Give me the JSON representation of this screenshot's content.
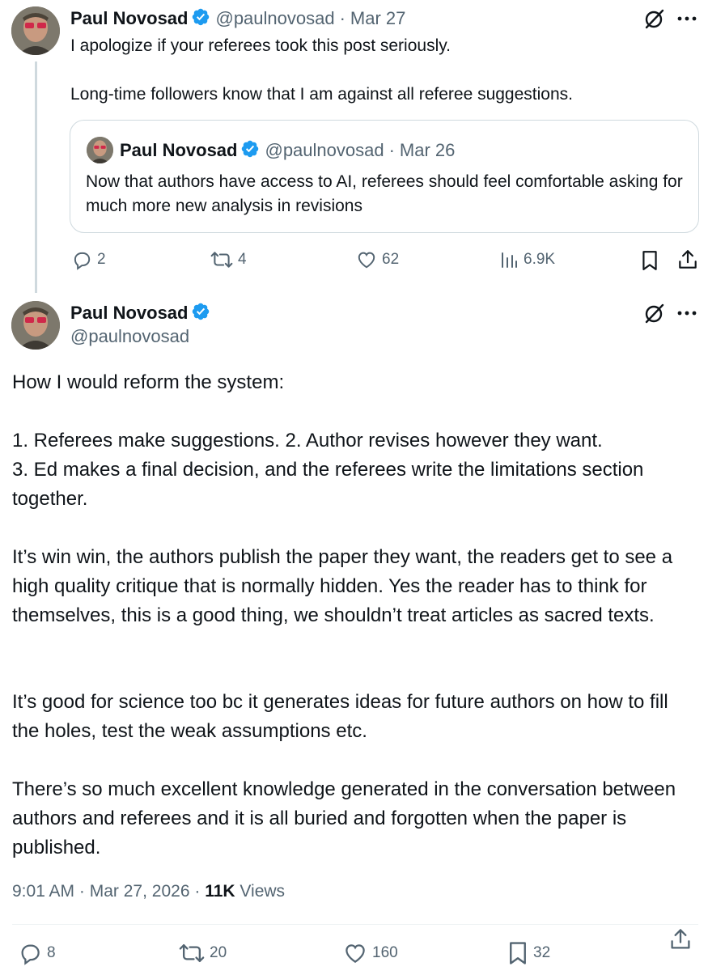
{
  "reply": {
    "author_name": "Paul Novosad",
    "handle": "@paulnovosad",
    "date": "Mar 27",
    "separator": "·",
    "lines": [
      "I apologize if your referees took this post seriously.",
      "Long-time followers know that I am against all referee suggestions."
    ],
    "quote": {
      "author_name": "Paul Novosad",
      "handle": "@paulnovosad",
      "date": "Mar 26",
      "text": "Now that authors have access to AI, referees should feel comfortable asking for much more new analysis in revisions"
    },
    "stats": {
      "replies": "2",
      "reposts": "4",
      "likes": "62",
      "views": "6.9K"
    }
  },
  "main": {
    "author_name": "Paul Novosad",
    "handle": "@paulnovosad",
    "paragraphs": [
      "How I would reform the system:",
      "1. Referees make suggestions. 2. Author revises however they want.\n3. Ed makes a final decision, and the referees write the limitations section together.",
      "It’s win win, the authors publish the paper they want, the readers get to see a high quality critique that is normally hidden. Yes the reader has to think for themselves, this is a good thing, we shouldn’t treat articles as sacred texts.",
      "It’s good for science too bc it generates ideas for future authors on how to fill the holes, test the weak assumptions etc.",
      "There’s so much excellent knowledge generated in the conversation between authors and referees and it is all buried and forgotten when the paper is published."
    ],
    "time": "9:01 AM",
    "full_date": "Mar 27, 2026",
    "views_count": "11K",
    "views_label": "Views",
    "stats": {
      "replies": "8",
      "reposts": "20",
      "likes": "160",
      "bookmarks": "32"
    }
  },
  "colors": {
    "text": "#0f1419",
    "secondary": "#536471",
    "verified": "#1d9bf0",
    "border": "#cfd9de"
  },
  "icons": [
    "verified-badge-icon",
    "grok-icon",
    "more-icon",
    "reply-icon",
    "repost-icon",
    "like-icon",
    "views-icon",
    "bookmark-icon",
    "share-icon"
  ]
}
